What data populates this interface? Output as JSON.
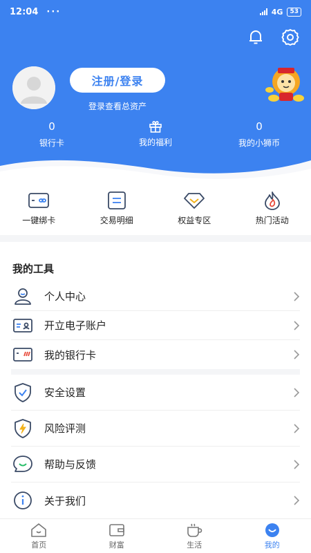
{
  "status_bar": {
    "time": "12:04",
    "dots": "···",
    "network": "4G",
    "battery": "53"
  },
  "header": {
    "login_button": "注册/登录",
    "login_hint": "登录查看总资产",
    "stats": [
      {
        "value": "0",
        "label": "银行卡"
      },
      {
        "value": "",
        "label": "我的福利"
      },
      {
        "value": "0",
        "label": "我的小狮币"
      }
    ]
  },
  "quick_actions": [
    {
      "label": "一键绑卡",
      "icon": "card-link-icon"
    },
    {
      "label": "交易明细",
      "icon": "transaction-list-icon"
    },
    {
      "label": "权益专区",
      "icon": "diamond-icon"
    },
    {
      "label": "热门活动",
      "icon": "flame-icon"
    }
  ],
  "tools": {
    "title": "我的工具",
    "group1": [
      {
        "label": "个人中心",
        "icon": "user-icon"
      },
      {
        "label": "开立电子账户",
        "icon": "id-card-icon"
      },
      {
        "label": "我的银行卡",
        "icon": "bank-card-icon"
      }
    ],
    "group2": [
      {
        "label": "安全设置",
        "icon": "shield-check-icon"
      },
      {
        "label": "风险评测",
        "icon": "shield-bolt-icon"
      },
      {
        "label": "帮助与反馈",
        "icon": "chat-smile-icon"
      },
      {
        "label": "关于我们",
        "icon": "info-icon"
      }
    ]
  },
  "bottom_nav": [
    {
      "label": "首页",
      "icon": "home-icon"
    },
    {
      "label": "财富",
      "icon": "wallet-icon"
    },
    {
      "label": "生活",
      "icon": "coffee-cup-icon"
    },
    {
      "label": "我的",
      "icon": "profile-icon",
      "active": true
    }
  ],
  "colors": {
    "brand": "#3c82f0",
    "icon_stroke": "#3a4a66",
    "accent_yellow": "#f2b21b",
    "accent_red": "#e84a3a"
  }
}
